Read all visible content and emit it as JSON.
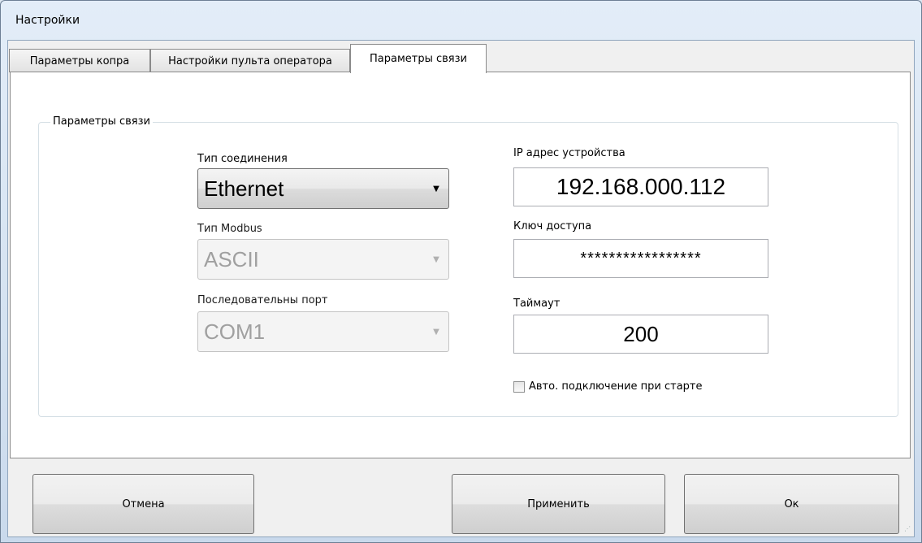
{
  "window": {
    "title": "Настройки"
  },
  "tabs": [
    {
      "label": "Параметры копра",
      "active": false
    },
    {
      "label": "Настройки пульта оператора",
      "active": false
    },
    {
      "label": "Параметры связи",
      "active": true
    }
  ],
  "group": {
    "title": "Параметры связи",
    "connection_type": {
      "label": "Тип соединения",
      "value": "Ethernet",
      "enabled": true
    },
    "modbus_type": {
      "label": "Тип Modbus",
      "value": "ASCII",
      "enabled": false
    },
    "serial_port": {
      "label": "Последовательны порт",
      "value": "COM1",
      "enabled": false
    },
    "ip_address": {
      "label": "IP адрес устройства",
      "value": "192.168.000.112"
    },
    "access_key": {
      "label": "Ключ доступа",
      "value": "*****************"
    },
    "timeout": {
      "label": "Таймаут",
      "value": "200"
    },
    "auto_connect": {
      "label": "Авто. подключение при старте",
      "checked": false
    }
  },
  "buttons": {
    "cancel": "Отмена",
    "apply": "Применить",
    "ok": "Ок"
  },
  "icons": {
    "dropdown": "chevron-down-icon"
  }
}
